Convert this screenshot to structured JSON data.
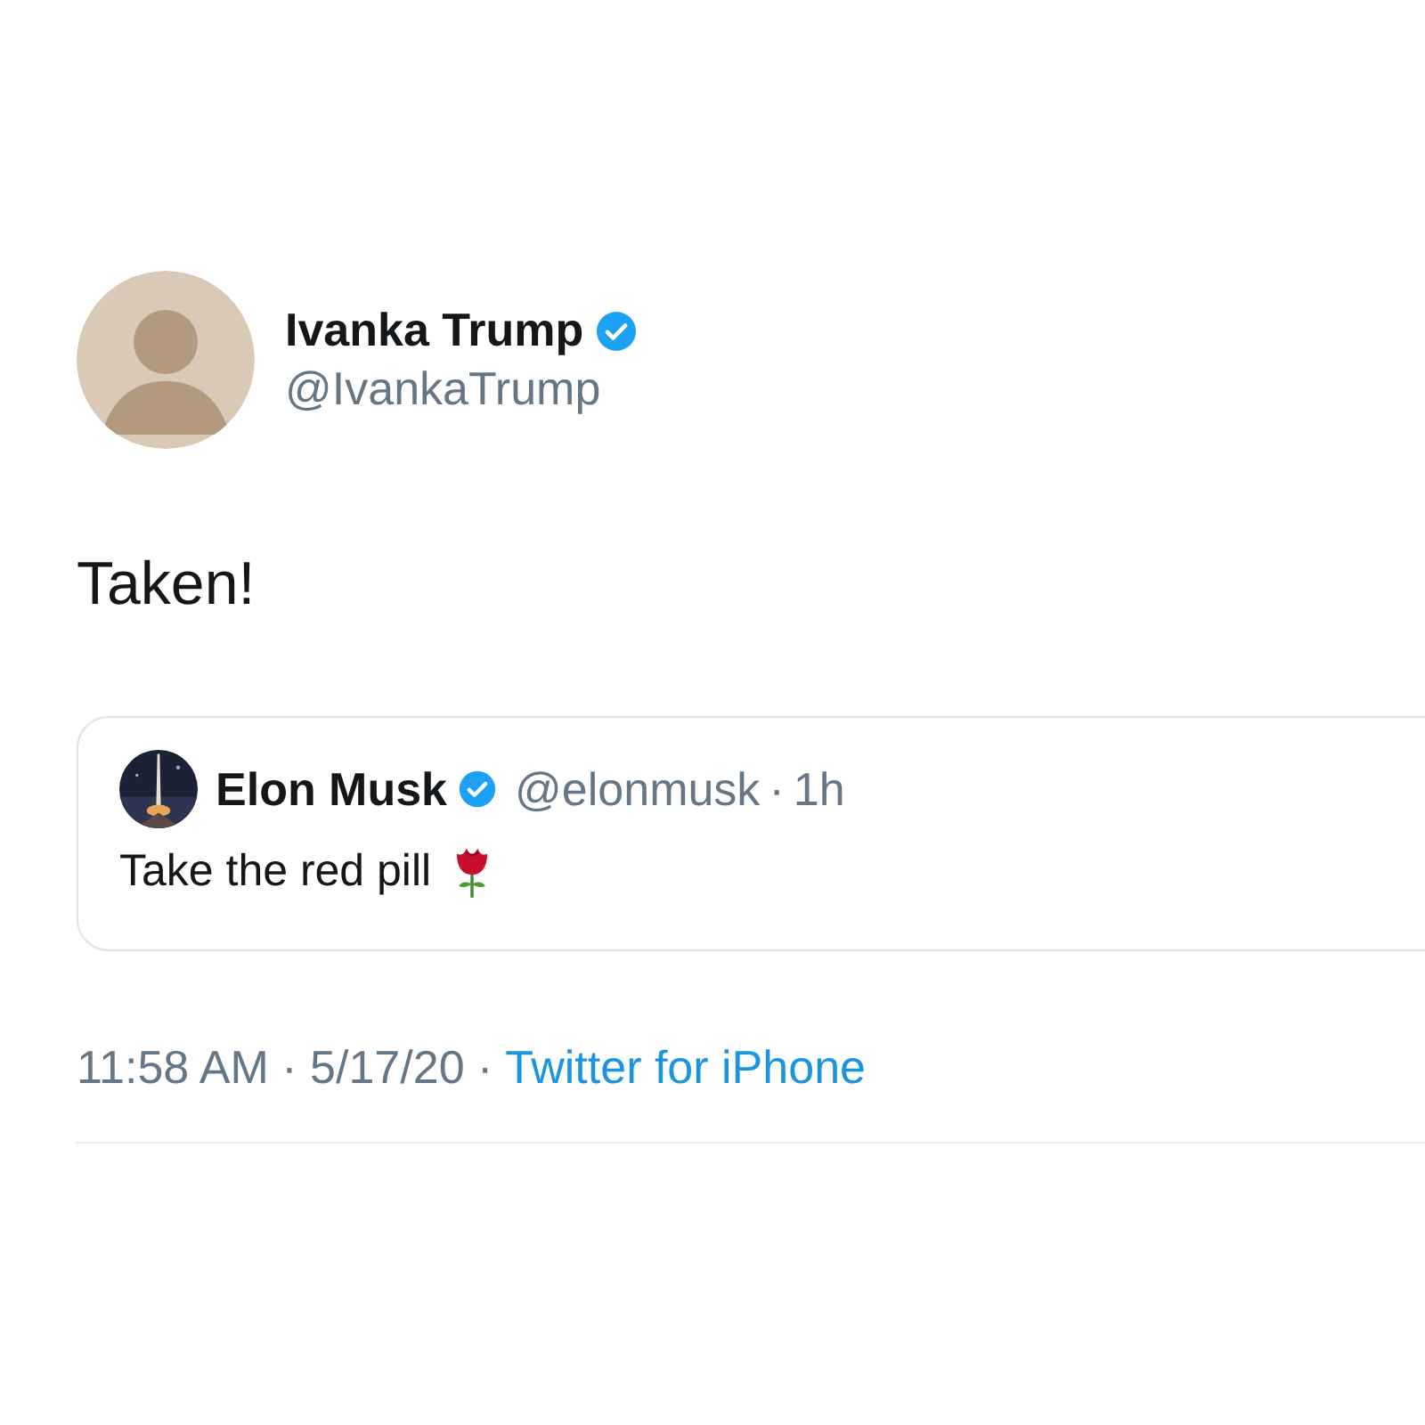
{
  "tweet": {
    "author": {
      "name": "Ivanka Trump",
      "handle": "@IvankaTrump",
      "verified": true
    },
    "text": "Taken!",
    "quoted": {
      "author": {
        "name": "Elon Musk",
        "handle": "@elonmusk",
        "verified": true
      },
      "separator": "·",
      "time": "1h",
      "text": "Take the red pill"
    },
    "meta": "11:58 AM · 5/17/20 ·",
    "source": "Twitter for iPhone"
  }
}
